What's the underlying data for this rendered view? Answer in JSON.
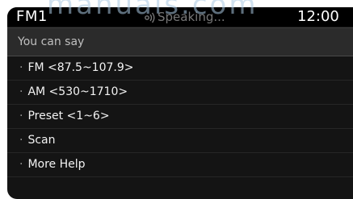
{
  "status_bar": {
    "mode": "FM1",
    "voice_status": "Speaking...",
    "clock": "12:00",
    "watermark": "manuals.com"
  },
  "help_panel": {
    "header": "You can say",
    "bullet": "·",
    "commands": [
      "FM <87.5~107.9>",
      "AM <530~1710>",
      "Preset <1~6>",
      "Scan",
      "More Help"
    ]
  },
  "colors": {
    "background": "#141414",
    "status_bar": "#000000",
    "header_row": "#2b2b2b",
    "text_primary": "#f2f2f2",
    "text_muted": "#bfbfbf",
    "voice_status": "#777777"
  },
  "icons": {
    "voice": "speaking-voice-icon"
  }
}
